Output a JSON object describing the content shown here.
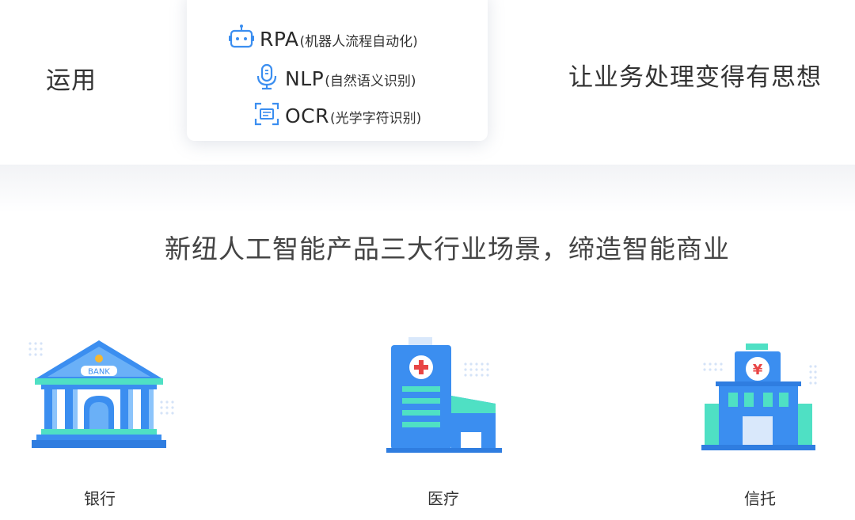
{
  "header": {
    "left_text": "运用",
    "right_text": "让业务处理变得有思想"
  },
  "techs": [
    {
      "code": "RPA",
      "desc": "(机器人流程自动化)",
      "icon": "robot-icon"
    },
    {
      "code": "NLP",
      "desc": "(自然语义识别)",
      "icon": "microphone-icon"
    },
    {
      "code": "OCR",
      "desc": "(光学字符识别)",
      "icon": "scan-icon"
    }
  ],
  "section": {
    "headline": "新纽人工智能产品三大行业场景，缔造智能商业"
  },
  "industries": [
    {
      "label": "银行",
      "icon": "bank-icon",
      "sign": "BANK"
    },
    {
      "label": "医疗",
      "icon": "hospital-icon"
    },
    {
      "label": "信托",
      "icon": "trust-icon",
      "sign": "¥"
    }
  ],
  "colors": {
    "blue": "#3b8ef0",
    "teal": "#4fe0c4",
    "light_blue": "#d9e8fb",
    "accent_red": "#e84545",
    "gold": "#f5b731"
  }
}
